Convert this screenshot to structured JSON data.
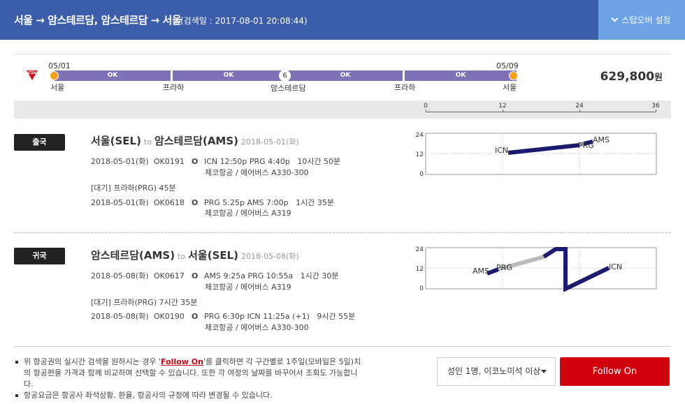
{
  "header": {
    "route": "서울 → 암스테르담, 암스테르담 → 서울",
    "search_date": "(검색일 : 2017-08-01 20:08:44)",
    "stopover_button": "스탑오버 설정"
  },
  "summary": {
    "airline_logo": "CSA",
    "start_date": "05/01",
    "end_date": "05/09",
    "points": [
      "서울",
      "프라하",
      "암스테르담",
      "프라하",
      "서울"
    ],
    "segments": [
      "OK",
      "OK",
      "OK",
      "OK"
    ],
    "stay_days": "6",
    "price": "629,800",
    "currency": "원"
  },
  "scale": {
    "ticks": [
      "0",
      "12",
      "24",
      "36"
    ]
  },
  "outbound": {
    "badge": "출국",
    "from": "서울(SEL)",
    "to_word": "to",
    "to": "암스테르담(AMS)",
    "date": "2018-05-01(화)",
    "flights": [
      {
        "date": "2018-05-01(화)",
        "flight": "OK0191",
        "mark": "O",
        "route": "ICN 12:50p PRG 4:40p",
        "duration": "10시간 50분",
        "detail": "체코항공 / 에어버스 A330-300"
      },
      {
        "date": "2018-05-01(화)",
        "flight": "OK0618",
        "mark": "O",
        "route": "PRG 5:25p AMS 7:00p",
        "duration": "1시간 35분",
        "detail": "체코항공 / 에어버스 A319"
      }
    ],
    "wait": "[대기] 프라하(PRG)  45분",
    "chart": {
      "y_ticks": [
        "24",
        "12",
        "0"
      ],
      "labels": [
        "ICN",
        "PRG",
        "AMS"
      ],
      "colors": {
        "flight": "#1a1a6e",
        "layover": "#bbbbbb"
      }
    }
  },
  "inbound": {
    "badge": "귀국",
    "from": "암스테르담(AMS)",
    "to_word": "to",
    "to": "서울(SEL)",
    "date": "2018-05-08(화)",
    "flights": [
      {
        "date": "2018-05-08(화)",
        "flight": "OK0617",
        "mark": "O",
        "route": "AMS 9:25a PRG 10:55a",
        "duration": "1시간 30분",
        "detail": "체코항공 / 에어버스 A319"
      },
      {
        "date": "2018-05-08(화)",
        "flight": "OK0190",
        "mark": "O",
        "route": "PRG 6:30p ICN 11:25a (+1)",
        "duration": "9시간 55분",
        "detail": "체코항공 / 에어버스 A330-300"
      }
    ],
    "wait": "[대기] 프라하(PRG)  7시간 35분",
    "chart": {
      "y_ticks": [
        "24",
        "12",
        "0"
      ],
      "labels": [
        "AMS",
        "PRG",
        "ICN"
      ]
    }
  },
  "footer": {
    "note1_pre": "위 항공권의 실시간 검색을 원하시는 경우 '",
    "note1_link": "Follow On",
    "note1_post": "'를 클릭하면 각 구간별로 1주일(모바일은 5일)치의 항공편을 가격과 함께 비교하며 선택할 수 있습니다. 또한 각 여정의 날짜를 바꾸어서 조회도 가능합니다.",
    "note2": "항공요금은 항공사 좌석상황, 환율, 항공사의 규정에 따라 변경될 수 있습니다.",
    "pax_select": "성인 1명, 이코노미석 이상",
    "follow_button": "Follow On"
  }
}
